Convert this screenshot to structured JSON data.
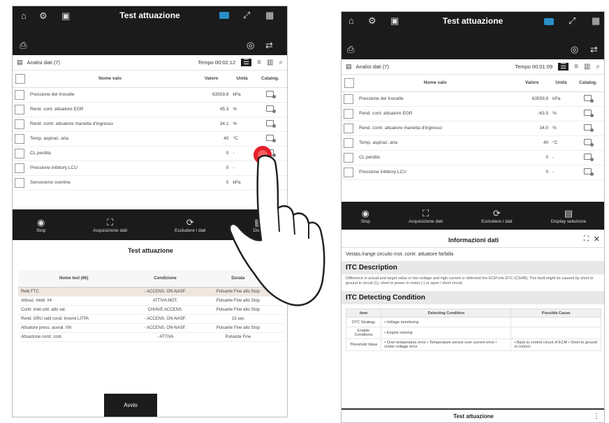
{
  "left_screen": {
    "topbar": {
      "title": "Test attuazione"
    },
    "toolbar": {
      "section": "Analisi dati (7)",
      "time": "Tempo 00:02:12"
    },
    "table": {
      "headers": [
        "Nome valo",
        "Valore",
        "Unità",
        "Catalog."
      ],
      "rows": [
        {
          "name": "Pressione del Inocelle",
          "value": "63559,8",
          "unit": "kPa"
        },
        {
          "name": "Rend. cont. attuatore EGR",
          "value": "45.3",
          "unit": "%"
        },
        {
          "name": "Rend. contr. attuatore manetta d'ingresso",
          "value": "34.1",
          "unit": "%"
        },
        {
          "name": "Temp. aspiraz. aria",
          "value": "40",
          "unit": "°C"
        },
        {
          "name": "CL perdita",
          "value": "0",
          "unit": "-"
        },
        {
          "name": "Pressione inibitory LCU",
          "value": "0",
          "unit": "-"
        },
        {
          "name": "Sensoremo overline",
          "value": "0",
          "unit": "kPa"
        }
      ]
    },
    "actionbar": [
      {
        "label": "Stop",
        "icon": "stop-icon",
        "sym": "◉"
      },
      {
        "label": "Acquisizione dati",
        "icon": "capture-icon",
        "sym": "⛶"
      },
      {
        "label": "Escludere i dati",
        "icon": "refresh-icon",
        "sym": "⟳"
      },
      {
        "label": "Dispo",
        "icon": "display-icon",
        "sym": "▤"
      }
    ],
    "section_title": "Test attuazione",
    "dtc_table": {
      "headers": [
        "Nome test (66)",
        "Condizione",
        "Durata",
        ""
      ],
      "rows": [
        {
          "name": "Relè FTC",
          "condition": "- ACCENS. ON-NASF.",
          "duration": "Pulsante Fine alto Stop",
          "selected": true
        },
        {
          "name": "Attivaz. iniett. #4",
          "condition": "ATTIVA MOT.",
          "duration": "Pulsante Fine alto Stop",
          "selected": false
        },
        {
          "name": "Contr. iniet.unit. atto val.",
          "condition": "CHIAVE ACCENS.",
          "duration": "Pulsante Fine alto Stop",
          "selected": false
        },
        {
          "name": "Rend. GRU valit cond. Inverni LITPA",
          "condition": "- ACCENS. ON-NASF.",
          "duration": "15 sec",
          "selected": false
        },
        {
          "name": "Attuatore press. aceral. VN",
          "condition": "- ACCENS. ON-NASF.",
          "duration": "Pulsante Fine alto Stop",
          "selected": false
        },
        {
          "name": "Attuazione contr. cont.",
          "condition": "- ATTIVA",
          "duration": "Pulsante Fine",
          "selected": false
        }
      ]
    },
    "close_button": "Avvio"
  },
  "right_screen": {
    "topbar": {
      "title": "Test attuazione"
    },
    "toolbar": {
      "section": "Analisi dati (7)",
      "time": "Tempo 00:01:09"
    },
    "table": {
      "headers": [
        "Nome valo",
        "Valore",
        "Unità",
        "Catalog."
      ],
      "rows": [
        {
          "name": "Pressione del Inocelle",
          "value": "63559,8",
          "unit": "kPa"
        },
        {
          "name": "Rend. cont. attuatore EGR",
          "value": "-63.5",
          "unit": "%"
        },
        {
          "name": "Rend. contr. attuatore manetta d'ingresso",
          "value": "34.0",
          "unit": "%"
        },
        {
          "name": "Temp. aspiraz. aria",
          "value": "40",
          "unit": "°C"
        },
        {
          "name": "CL perdita",
          "value": "0",
          "unit": "-"
        },
        {
          "name": "Pressione inibitory LCU",
          "value": "0",
          "unit": "-"
        }
      ]
    },
    "actionbar": [
      {
        "label": "Stop",
        "icon": "stop-icon",
        "sym": "◉"
      },
      {
        "label": "Acquisizione dati",
        "icon": "capture-icon",
        "sym": "⛶"
      },
      {
        "label": "Escludere i dati",
        "icon": "refresh-icon",
        "sym": "⟳"
      },
      {
        "label": "Display selezione",
        "icon": "display-icon",
        "sym": "▤"
      }
    ],
    "info_panel": {
      "title": "Informazioni dati",
      "subtitle": "Vestas./range circuito mot. contr. attuatore farfalla",
      "desc_title": "ITC Description",
      "desc_text": "Difference in actual and target value or low voltage and high current or detected the ECM into ETC (CSHB). This fault might be caused by short to ground in circuit (1), short to power in motor (-) or open / short circuit.",
      "cond_title": "ITC Detecting Condition",
      "cond_headers": [
        "Item",
        "Detecting Condition",
        "Possible Cause"
      ],
      "cond_rows": [
        {
          "item": "DTC Strategy",
          "condition": "• Voltage monitoring",
          "cause": ""
        },
        {
          "item": "Enable Conditions",
          "condition": "• Engine running",
          "cause": ""
        },
        {
          "item": "Threshold Value",
          "condition": "• Over temperature error • Temperature sensor over current error • Under voltage error",
          "cause": "• Back to control circuit of ECM • Short to ground in control"
        }
      ]
    },
    "bottom_title": "Test attuazione"
  }
}
